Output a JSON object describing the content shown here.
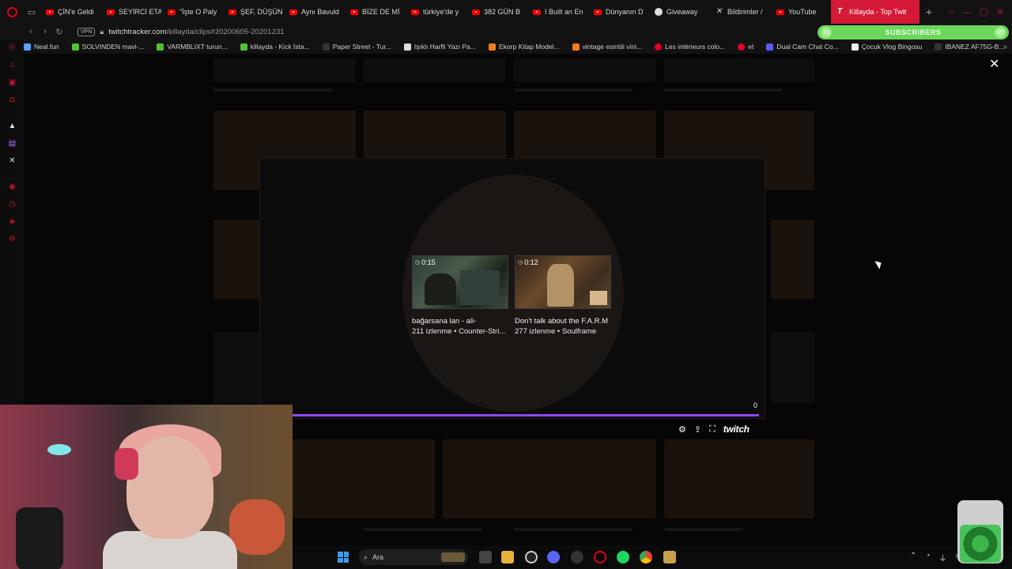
{
  "tabs": [
    {
      "label": "ÇİN'e Geldi",
      "icon": "youtube-icon"
    },
    {
      "label": "SEYİRCİ ETA",
      "icon": "youtube-icon"
    },
    {
      "label": "\"İşte O Paly",
      "icon": "youtube-icon"
    },
    {
      "label": "ŞEF, DÜŞÜN",
      "icon": "youtube-icon"
    },
    {
      "label": "Aynı Bavuld",
      "icon": "youtube-icon"
    },
    {
      "label": "BİZE DE Mİ",
      "icon": "youtube-icon"
    },
    {
      "label": "türkiye'de y",
      "icon": "youtube-icon"
    },
    {
      "label": "382 GÜN B",
      "icon": "youtube-icon"
    },
    {
      "label": "I Built an En",
      "icon": "youtube-icon"
    },
    {
      "label": "Dünyanın D",
      "icon": "youtube-icon"
    },
    {
      "label": "Giveaway",
      "icon": "github-icon"
    },
    {
      "label": "Bildirimler /",
      "icon": "x-icon"
    },
    {
      "label": "YouTube",
      "icon": "youtube-icon"
    },
    {
      "label": "Killayda - Top Twit",
      "icon": "twitchtracker-icon",
      "active": true
    }
  ],
  "address": {
    "vpn": "VPN",
    "url_host": "twitchtracker.com",
    "url_path": "/killayda/clips#20200605-20201231"
  },
  "subscribers_widget": {
    "label": "SUBSCRIBERS",
    "left": "20",
    "right": "20"
  },
  "bookmarks": [
    {
      "label": "Neal.fun",
      "color": "#5aa0ff"
    },
    {
      "label": "SOLVINDEN mavi-...",
      "color": "#52c234"
    },
    {
      "label": "VARMBLIXT turun...",
      "color": "#52c234"
    },
    {
      "label": "killayda - Kick İsta...",
      "color": "#52c234"
    },
    {
      "label": "Paper Street - Tur...",
      "color": "#333333"
    },
    {
      "label": "Işıklı Harfli Yazı Pa...",
      "color": "#dddddd"
    },
    {
      "label": "Ekorp Kitap Model...",
      "color": "#f47a20"
    },
    {
      "label": "vintage esintili vini...",
      "color": "#f47a20"
    },
    {
      "label": "Les intérieurs colo...",
      "color": "#e60023"
    },
    {
      "label": "et",
      "color": "#e60023"
    },
    {
      "label": "Dual Cam Chat Co...",
      "color": "#5a5aff"
    },
    {
      "label": "Çocuk Vlog Bingosu",
      "color": "#eeeeee"
    },
    {
      "label": "IBANEZ AF75G-B...",
      "color": "#333333"
    }
  ],
  "clips": [
    {
      "duration": "0:15",
      "title": "bağarsana lan - ali-",
      "meta": "211 izlenme • Counter-Stri..."
    },
    {
      "duration": "0:12",
      "title": "Don't talk about the F.A.R.M",
      "meta": "277 izlenme • Soulframe"
    }
  ],
  "player": {
    "counter": "0",
    "brand": "twitch",
    "progress": 1.0
  },
  "taskbar": {
    "search_placeholder": "Ara"
  },
  "colors": {
    "accent": "#9146ff",
    "tab_active": "#d41a36",
    "subscribers": "#6ad65a"
  }
}
